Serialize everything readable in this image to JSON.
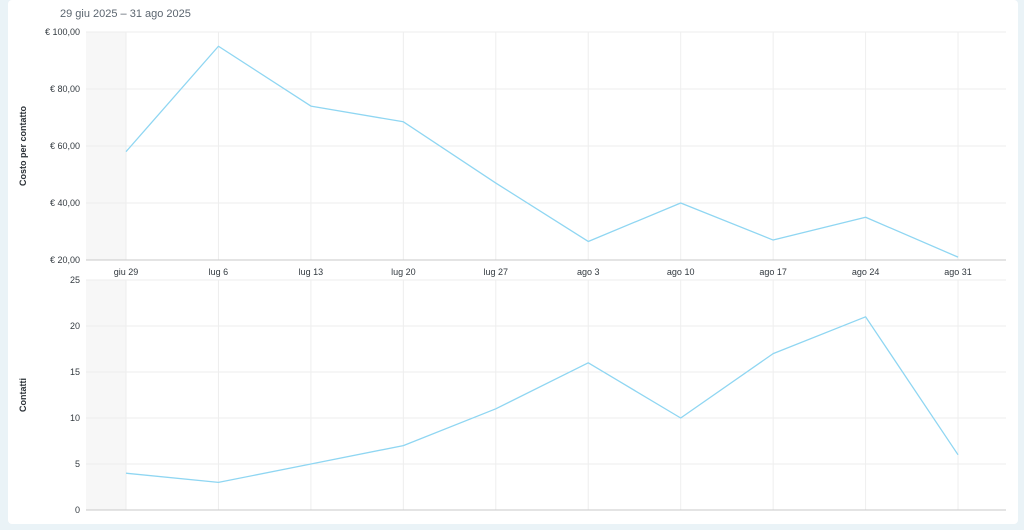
{
  "header": {
    "date_range": "29 giu 2025 – 31 ago 2025"
  },
  "colors": {
    "line": "#8fd6f2",
    "grid": "#eeeeee",
    "axis": "#c9c9c9",
    "shade": "#f7f7f7"
  },
  "chart_data": [
    {
      "type": "line",
      "ylabel": "Costo per contatto",
      "x": [
        "giu 29",
        "lug 6",
        "lug 13",
        "lug 20",
        "lug 27",
        "ago 3",
        "ago 10",
        "ago 17",
        "ago 24",
        "ago 31"
      ],
      "series": [
        {
          "values": [
            58,
            95,
            74,
            68.5,
            47,
            26.5,
            40,
            27,
            35,
            21
          ]
        }
      ],
      "yticks": [
        20,
        40,
        60,
        80,
        100
      ],
      "ytick_labels": [
        "€ 20,00",
        "€ 40,00",
        "€ 60,00",
        "€ 80,00",
        "€ 100,00"
      ],
      "ylim": [
        20,
        100
      ],
      "grid": true
    },
    {
      "type": "line",
      "ylabel": "Contatti",
      "x": [
        "giu 29",
        "lug 6",
        "lug 13",
        "lug 20",
        "lug 27",
        "ago 3",
        "ago 10",
        "ago 17",
        "ago 24",
        "ago 31"
      ],
      "series": [
        {
          "values": [
            4,
            3,
            5,
            7,
            11,
            16,
            10,
            17,
            21,
            6
          ]
        }
      ],
      "yticks": [
        0,
        5,
        10,
        15,
        20,
        25
      ],
      "ytick_labels": [
        "0",
        "5",
        "10",
        "15",
        "20",
        "25"
      ],
      "ylim": [
        0,
        25
      ],
      "grid": true
    }
  ]
}
